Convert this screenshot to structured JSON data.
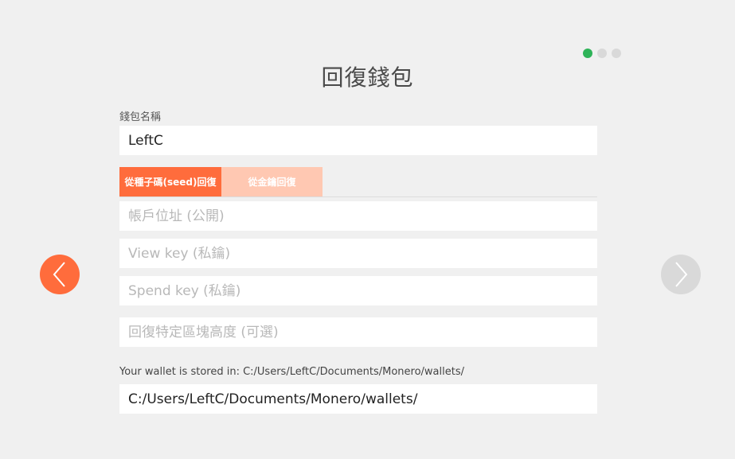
{
  "progress": {
    "steps": 3,
    "current": 1,
    "active_color": "#2eb358"
  },
  "page": {
    "title": "回復錢包"
  },
  "wallet_name": {
    "label": "錢包名稱",
    "value": "LeftC"
  },
  "restore_tabs": [
    {
      "label": "從種子碼(seed)回復",
      "active": true
    },
    {
      "label": "從金鑰回復",
      "active": false
    }
  ],
  "fields": {
    "account_address": {
      "placeholder": "帳戶位址 (公開)"
    },
    "view_key": {
      "placeholder": "View key (私鑰)"
    },
    "spend_key": {
      "placeholder": "Spend key (私鑰)"
    },
    "restore_height": {
      "placeholder": "回復特定區塊高度 (可選)"
    }
  },
  "storage": {
    "label": "Your wallet is stored in: C:/Users/LeftC/Documents/Monero/wallets/",
    "path_value": "C:/Users/LeftC/Documents/Monero/wallets/"
  },
  "nav": {
    "back_icon": "chevron-left-icon",
    "next_icon": "chevron-right-icon",
    "back_color": "#ff6c3c",
    "next_color": "#d9d9d9"
  }
}
